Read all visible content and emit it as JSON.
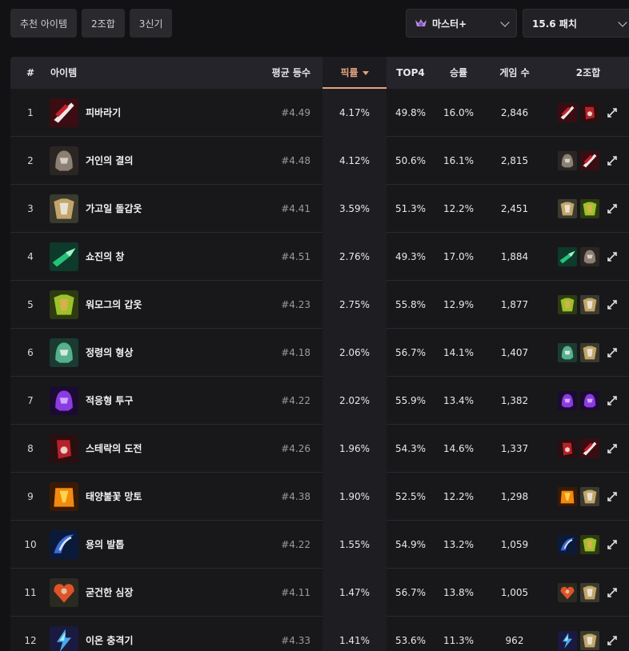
{
  "tabs": [
    {
      "label": "추천 아이템",
      "active": true
    },
    {
      "label": "2조합",
      "active": false
    },
    {
      "label": "3신기",
      "active": false
    }
  ],
  "filters": {
    "tier": "마스터+",
    "tier_icon": "master-emblem-icon",
    "patch": "15.6 패치"
  },
  "columns": {
    "rank": "#",
    "item": "아이템",
    "avg_place": "평균 등수",
    "pick_rate": "픽률",
    "top4": "TOP4",
    "win_rate": "승률",
    "games": "게임 수",
    "combo": "2조합"
  },
  "colors": {
    "accent": "#e3a17d",
    "background": "#121214",
    "row": "#18181b"
  },
  "rows": [
    {
      "rank": "1",
      "name": "피바라기",
      "icon": "bloodthirster-icon",
      "avg": "#4.49",
      "pick": "4.17%",
      "top4": "49.8%",
      "win": "16.0%",
      "games": "2,846",
      "combo": [
        "bloodthirster-icon",
        "sterak-icon"
      ]
    },
    {
      "rank": "2",
      "name": "거인의 결의",
      "icon": "titans-resolve-icon",
      "avg": "#4.48",
      "pick": "4.12%",
      "top4": "50.6%",
      "win": "16.1%",
      "games": "2,815",
      "combo": [
        "titans-resolve-icon",
        "bloodthirster-icon"
      ]
    },
    {
      "rank": "3",
      "name": "가고일 돌갑옷",
      "icon": "gargoyle-icon",
      "avg": "#4.41",
      "pick": "3.59%",
      "top4": "51.3%",
      "win": "12.2%",
      "games": "2,451",
      "combo": [
        "gargoyle-icon",
        "warmog-icon"
      ]
    },
    {
      "rank": "4",
      "name": "쇼진의 창",
      "icon": "shojin-icon",
      "avg": "#4.51",
      "pick": "2.76%",
      "top4": "49.3%",
      "win": "17.0%",
      "games": "1,884",
      "combo": [
        "shojin-icon",
        "titans-resolve-icon"
      ]
    },
    {
      "rank": "5",
      "name": "워모그의 갑옷",
      "icon": "warmog-icon",
      "avg": "#4.23",
      "pick": "2.75%",
      "top4": "55.8%",
      "win": "12.9%",
      "games": "1,877",
      "combo": [
        "warmog-icon",
        "gargoyle-icon"
      ]
    },
    {
      "rank": "6",
      "name": "정령의 형상",
      "icon": "spirit-visage-icon",
      "avg": "#4.18",
      "pick": "2.06%",
      "top4": "56.7%",
      "win": "14.1%",
      "games": "1,407",
      "combo": [
        "spirit-visage-icon",
        "gargoyle-icon"
      ]
    },
    {
      "rank": "7",
      "name": "적응형 투구",
      "icon": "adaptive-helm-icon",
      "avg": "#4.22",
      "pick": "2.02%",
      "top4": "55.9%",
      "win": "13.4%",
      "games": "1,382",
      "combo": [
        "adaptive-helm-icon",
        "adaptive-helm-icon"
      ]
    },
    {
      "rank": "8",
      "name": "스테락의 도전",
      "icon": "sterak-icon",
      "avg": "#4.26",
      "pick": "1.96%",
      "top4": "54.3%",
      "win": "14.6%",
      "games": "1,337",
      "combo": [
        "sterak-icon",
        "bloodthirster-icon"
      ]
    },
    {
      "rank": "9",
      "name": "태양불꽃 망토",
      "icon": "sunfire-icon",
      "avg": "#4.38",
      "pick": "1.90%",
      "top4": "52.5%",
      "win": "12.2%",
      "games": "1,298",
      "combo": [
        "sunfire-icon",
        "gargoyle-icon"
      ]
    },
    {
      "rank": "10",
      "name": "용의 발톱",
      "icon": "dragon-claw-icon",
      "avg": "#4.22",
      "pick": "1.55%",
      "top4": "54.9%",
      "win": "13.2%",
      "games": "1,059",
      "combo": [
        "dragon-claw-icon",
        "warmog-icon"
      ]
    },
    {
      "rank": "11",
      "name": "굳건한 심장",
      "icon": "steadfast-heart-icon",
      "avg": "#4.11",
      "pick": "1.47%",
      "top4": "56.7%",
      "win": "13.8%",
      "games": "1,005",
      "combo": [
        "steadfast-heart-icon",
        "gargoyle-icon"
      ]
    },
    {
      "rank": "12",
      "name": "이온 충격기",
      "icon": "ionic-spark-icon",
      "avg": "#4.33",
      "pick": "1.41%",
      "top4": "53.6%",
      "win": "11.3%",
      "games": "962",
      "combo": [
        "ionic-spark-icon",
        "gargoyle-icon"
      ]
    }
  ]
}
